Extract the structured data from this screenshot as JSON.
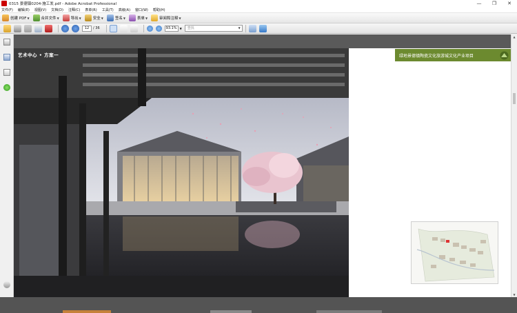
{
  "window": {
    "title": "0315 景德镇0204-施工发.pdf - Adobe Acrobat Professional",
    "minimize": "—",
    "maximize": "❐",
    "close": "✕"
  },
  "menu": [
    "文件(F)",
    "编辑(E)",
    "视图(V)",
    "文档(D)",
    "注释(C)",
    "表单(R)",
    "工具(T)",
    "高级(A)",
    "窗口(W)",
    "帮助(H)"
  ],
  "toolbar": {
    "create_pdf": "创建 PDF",
    "combine": "合并文件",
    "export": "导出",
    "secure": "安全",
    "sign": "签名",
    "forms": "表单",
    "review": "审阅和注释"
  },
  "nav": {
    "page_current": "12",
    "page_total": "/ 36",
    "zoom": "93.1%",
    "search_placeholder": "查找"
  },
  "document": {
    "page_heading": "艺术中心 • 方案一",
    "banner": "绿地景德镇陶瓷文化旅游城文化产业项目"
  },
  "colors": {
    "banner": "#6c8a2f",
    "doc_background": "#5a5a5a"
  }
}
